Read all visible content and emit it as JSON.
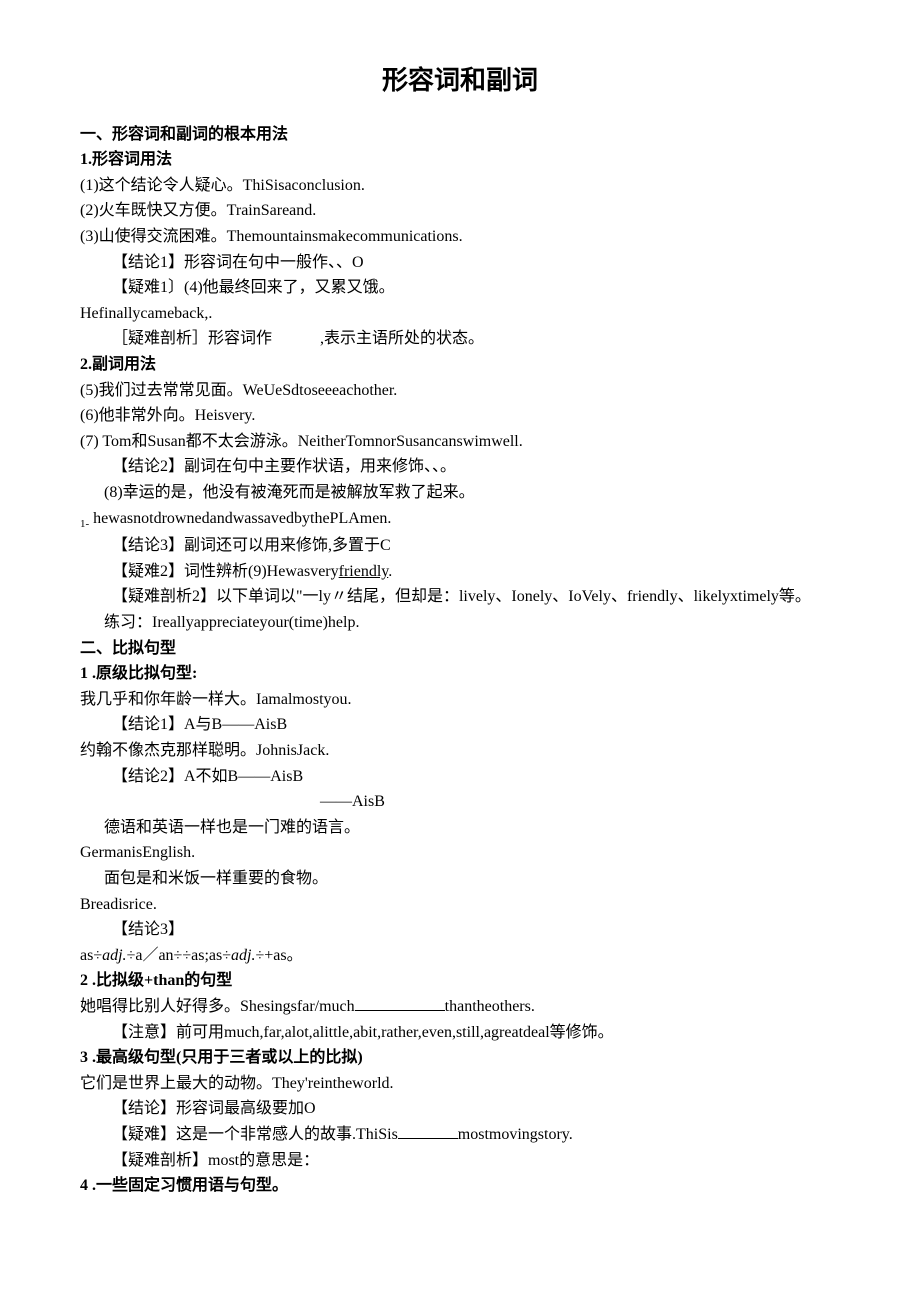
{
  "title": "形容词和副词",
  "s1": {
    "h": "一、形容词和副词的根本用法",
    "h1": "1.形容词用法",
    "l1": "(1)这个结论令人疑心。ThiSisaconclusion.",
    "l2": "(2)火车既快又方便。TrainSareand.",
    "l3": "(3)山使得交流困难。Themountainsmakecommunications.",
    "l4": "【结论1】形容词在句中一般作、、O",
    "l5": "【疑难1〕(4)他最终回来了，又累又饿。",
    "l6": "Hefinallycameback,.",
    "l7a": "［疑难剖析］形容词作",
    "l7b": ",表示主语所处的状态。",
    "h2": "2.副词用法",
    "l8": "(5)我们过去常常见面。WeUeSdtoseeeachother.",
    "l9": "(6)他非常外向。Heisvery.",
    "l10": "(7) Tom和Susan都不太会游泳。NeitherTomnorSusancanswimwell.",
    "l11": "【结论2】副词在句中主要作状语，用来修饰、、。",
    "l12": "(8)幸运的是，他没有被淹死而是被解放军救了起来。",
    "l13pre": "1-",
    "l13": "hewasnotdrownedandwassavedbythePLAmen.",
    "l14": "【结论3】副词还可以用来修饰,多置于C",
    "l15a": "【疑难2】词性辨析(9)Hewasvery",
    "l15u": "friendly",
    "l15b": ".",
    "l16": "【疑难剖析2】以下单词以\"一ly〃结尾，但却是：lively、Ionely、IoVely、friendly、likelyxtimely等。",
    "l17": "练习：Ireallyappreciateyour(time)help."
  },
  "s2": {
    "h": "二、比拟句型",
    "h1": "1 .原级比拟句型:",
    "l1": "我几乎和你年龄一样大。Iamalmostyou.",
    "l2": "【结论1】A与B——AisB",
    "l3": "约翰不像杰克那样聪明。JohnisJack.",
    "l4": "【结论2】A不如B——AisB",
    "l5": "——AisB",
    "l6": "德语和英语一样也是一门难的语言。",
    "l7": "GermanisEnglish.",
    "l8": "面包是和米饭一样重要的食物。",
    "l9": "Breadisrice.",
    "l10": "【结论3】",
    "l11a": "as÷",
    "l11i1": "adj.",
    "l11b": "÷a／an÷÷as;as÷",
    "l11i2": "adj.",
    "l11c": "÷+as。",
    "h2": "2 .比拟级+than的句型",
    "l12a": "她唱得比别人好得多。Shesingsfar/much",
    "l12b": "thantheothers.",
    "l13": "【注意】前可用much,far,alot,alittle,abit,rather,even,still,agreatdeal等修饰。",
    "h3": "3 .最高级句型(只用于三者或以上的比拟)",
    "l14": "它们是世界上最大的动物。They'reintheworld.",
    "l15": "【结论】形容词最高级要加O",
    "l16a": "【疑难】这是一个非常感人的故事.ThiSis",
    "l16b": "mostmovingstory.",
    "l17": "【疑难剖析】most的意思是：",
    "h4": "4 .一些固定习惯用语与句型。"
  }
}
